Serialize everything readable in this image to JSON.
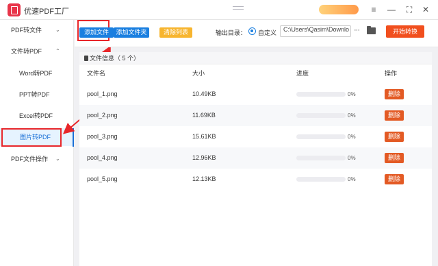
{
  "app": {
    "title": "优速PDF工厂",
    "window_controls": [
      "≡",
      "—",
      "⛶",
      "✕"
    ]
  },
  "sidebar": {
    "groups": [
      {
        "label": "PDF转文件",
        "chevron": "⌄"
      },
      {
        "label": "文件转PDF",
        "chevron": "⌃"
      },
      {
        "label": "PDF文件操作",
        "chevron": "⌄"
      }
    ],
    "sub_items": [
      {
        "label": "Word转PDF"
      },
      {
        "label": "PPT转PDF"
      },
      {
        "label": "Excel转PDF"
      },
      {
        "label": "图片转PDF",
        "active": true
      }
    ]
  },
  "toolbar": {
    "add_file": "添加文件",
    "add_folder": "添加文件夹",
    "clear_list": "清除列表",
    "output_label": "输出目录：",
    "custom_radio": "自定义",
    "output_path": "C:\\Users\\Qasim\\Downlo",
    "more": "···",
    "start": "开始转换"
  },
  "file_info": {
    "label": "文件信息（ 5 个）"
  },
  "table": {
    "headers": [
      "文件名",
      "大小",
      "进度",
      "操作"
    ],
    "rows": [
      {
        "name": "pool_1.png",
        "size": "10.49KB",
        "progress": 0,
        "progress_text": "0%",
        "action": "删除"
      },
      {
        "name": "pool_2.png",
        "size": "11.69KB",
        "progress": 0,
        "progress_text": "0%",
        "action": "删除"
      },
      {
        "name": "pool_3.png",
        "size": "15.61KB",
        "progress": 0,
        "progress_text": "0%",
        "action": "删除"
      },
      {
        "name": "pool_4.png",
        "size": "12.96KB",
        "progress": 0,
        "progress_text": "0%",
        "action": "删除"
      },
      {
        "name": "pool_5.png",
        "size": "12.13KB",
        "progress": 0,
        "progress_text": "0%",
        "action": "删除"
      }
    ]
  },
  "colors": {
    "accent_blue": "#1a7fe0",
    "clear_yellow": "#f7b52f",
    "start_orange": "#f14f1e",
    "delete_orange": "#e35a24",
    "annotation_red": "#e8262a"
  }
}
